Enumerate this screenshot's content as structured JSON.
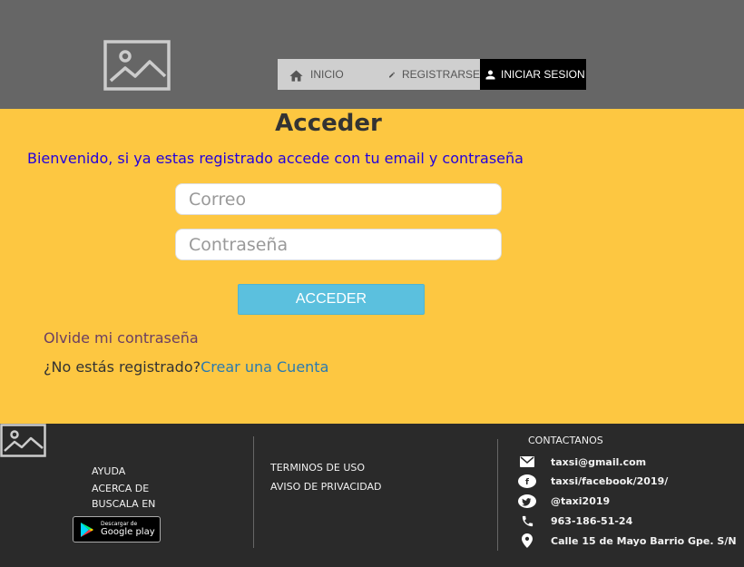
{
  "nav": {
    "items": [
      {
        "label": "INICIO",
        "icon": "home-icon"
      },
      {
        "label": "REGISTRARSE",
        "icon": "pencil-icon"
      },
      {
        "label": "INICIAR SESION",
        "icon": "person-icon"
      }
    ]
  },
  "login": {
    "title": "Acceder",
    "welcome": "Bienvenido, si ya estas registrado accede con tu email y contraseña",
    "email_placeholder": "Correo",
    "password_placeholder": "Contraseña",
    "submit_label": "ACCEDER",
    "forgot_label": "Olvide mi contraseña",
    "not_registered_text": "¿No estás registrado?",
    "create_account_label": "Crear una Cuenta"
  },
  "footer": {
    "links_col1": [
      "AYUDA",
      "ACERCA DE",
      "BUSCALA EN"
    ],
    "google_play": {
      "small": "Descargar de",
      "big": "Google play"
    },
    "links_col2": [
      "TERMINOS DE USO",
      "AVISO DE PRIVACIDAD"
    ],
    "contact_heading": "CONTACTANOS",
    "contacts": [
      {
        "icon": "mail-icon",
        "text": "taxsi@gmail.com"
      },
      {
        "icon": "facebook-icon",
        "text": "taxsi/facebook/2019/"
      },
      {
        "icon": "twitter-icon",
        "text": "@taxi2019"
      },
      {
        "icon": "phone-icon",
        "text": "963-186-51-24"
      },
      {
        "icon": "location-icon",
        "text": "Calle 15 de Mayo Barrio Gpe. S/N"
      }
    ]
  },
  "colors": {
    "header_bg": "#666666",
    "main_bg": "#fdc741",
    "footer_bg": "#2a2a2a",
    "button_bg": "#5bc0de",
    "welcome_text": "#2200dd",
    "link_text": "#2a7ab0"
  }
}
